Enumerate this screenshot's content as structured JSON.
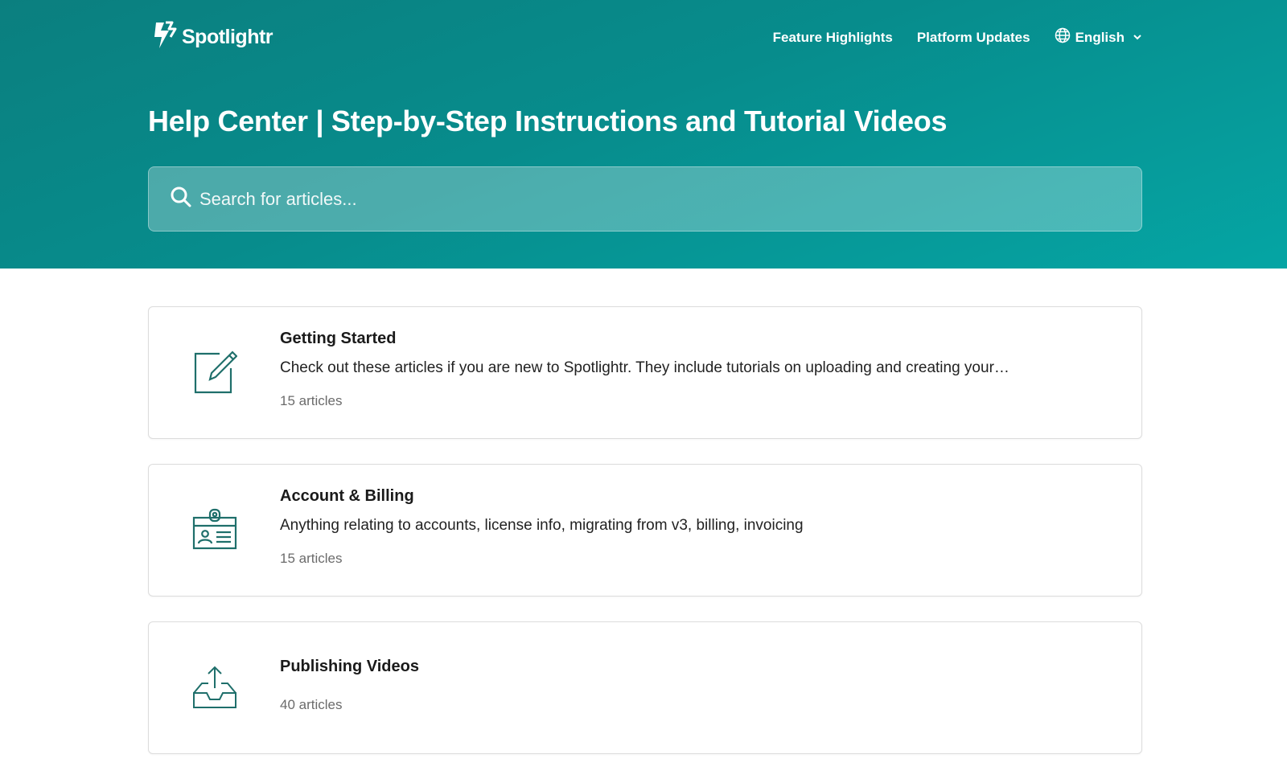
{
  "brand": {
    "name": "Spotlightr"
  },
  "nav": {
    "links": [
      "Feature Highlights",
      "Platform Updates"
    ],
    "language": "English"
  },
  "header": {
    "title": "Help Center | Step-by-Step Instructions and Tutorial Videos"
  },
  "search": {
    "placeholder": "Search for articles..."
  },
  "categories": [
    {
      "title": "Getting Started",
      "description": "Check out these articles if you are new to Spotlightr. They include tutorials on uploading and creating your…",
      "count": "15 articles",
      "icon": "edit-icon"
    },
    {
      "title": "Account & Billing",
      "description": "Anything relating to accounts, license info, migrating from v3, billing, invoicing",
      "count": "15 articles",
      "icon": "id-badge-icon"
    },
    {
      "title": "Publishing Videos",
      "description": "",
      "count": "40 articles",
      "icon": "upload-tray-icon"
    }
  ],
  "colors": {
    "accent": "#0b7f7f",
    "icon": "#1f6f6b"
  }
}
